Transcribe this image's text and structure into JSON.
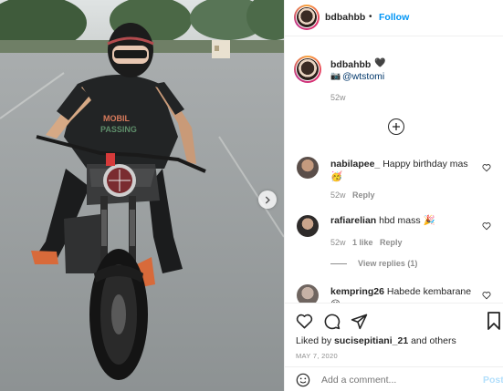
{
  "post": {
    "username": "bdbahbb",
    "follow_label": "Follow",
    "separator": "•"
  },
  "caption": {
    "username": "bdbahbb",
    "heart_emoji": "🖤",
    "camera_emoji": "📷",
    "mention": "@wtstomi",
    "time": "52w"
  },
  "comments": [
    {
      "username": "nabilapee_",
      "text": "Happy birthday mas",
      "emoji": "🥳",
      "time": "52w",
      "reply_label": "Reply"
    },
    {
      "username": "rafiarelian",
      "text": "hbd mass",
      "emoji": "🎉",
      "time": "52w",
      "likes": "1 like",
      "reply_label": "Reply",
      "view_replies": "View replies (1)"
    },
    {
      "username": "kempring26",
      "text": "Habede kembarane",
      "emoji": "😃"
    }
  ],
  "actions": {
    "liked_by_prefix": "Liked by",
    "liked_by_user": "sucisepitiani_21",
    "liked_by_suffix": "and others",
    "date": "MAY 7, 2020"
  },
  "add_comment": {
    "placeholder": "Add a comment...",
    "post_label": "Post"
  },
  "photo": {
    "tshirt_line1": "MOBIL",
    "tshirt_line2": "PASSING"
  },
  "colors": {
    "follow_blue": "#0095f6",
    "text": "#262626",
    "secondary": "#8e8e8e",
    "divider": "#efefef"
  }
}
